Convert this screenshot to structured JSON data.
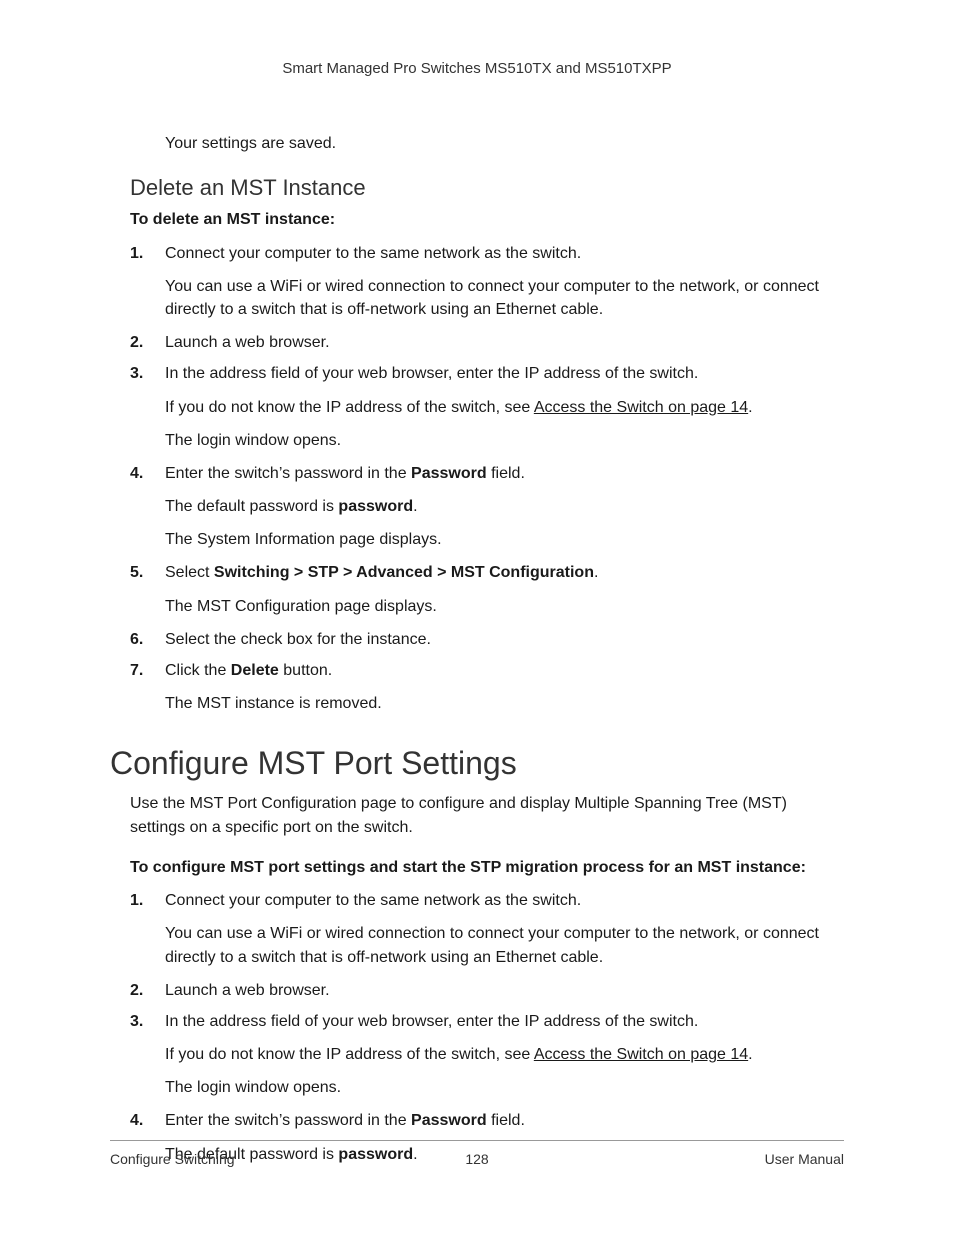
{
  "header": "Smart Managed Pro Switches MS510TX and MS510TXPP",
  "intro_saved": "Your settings are saved.",
  "sub1": {
    "title": "Delete an MST Instance",
    "lead": "To delete an MST instance:",
    "steps": {
      "s1": "Connect your computer to the same network as the switch.",
      "s1_p": "You can use a WiFi or wired connection to connect your computer to the network, or connect directly to a switch that is off-network using an Ethernet cable.",
      "s2": "Launch a web browser.",
      "s3": "In the address field of your web browser, enter the IP address of the switch.",
      "s3_p_pre": "If you do not know the IP address of the switch, see ",
      "s3_link": "Access the Switch on page 14",
      "s3_p_post": ".",
      "s3_p2": "The login window opens.",
      "s4_pre": "Enter the switch’s password in the ",
      "s4_bold": "Password",
      "s4_post": " field.",
      "s4_p_pre": "The default password is ",
      "s4_p_bold": "password",
      "s4_p_post": ".",
      "s4_p2": "The System Information page displays.",
      "s5_pre": "Select ",
      "s5_bold": "Switching > STP > Advanced > MST Configuration",
      "s5_post": ".",
      "s5_p": "The MST Configuration page displays.",
      "s6": "Select the check box for the instance.",
      "s7_pre": "Click the ",
      "s7_bold": "Delete",
      "s7_post": " button.",
      "s7_p": "The MST instance is removed."
    }
  },
  "section2": {
    "title": "Configure MST Port Settings",
    "intro": "Use the MST Port Configuration page to configure and display Multiple Spanning Tree (MST) settings on a specific port on the switch.",
    "lead": "To configure MST port settings and start the STP migration process for an MST instance:",
    "steps": {
      "s1": "Connect your computer to the same network as the switch.",
      "s1_p": "You can use a WiFi or wired connection to connect your computer to the network, or connect directly to a switch that is off-network using an Ethernet cable.",
      "s2": "Launch a web browser.",
      "s3": "In the address field of your web browser, enter the IP address of the switch.",
      "s3_p_pre": "If you do not know the IP address of the switch, see ",
      "s3_link": "Access the Switch on page 14",
      "s3_p_post": ".",
      "s3_p2": "The login window opens.",
      "s4_pre": "Enter the switch’s password in the ",
      "s4_bold": "Password",
      "s4_post": " field.",
      "s4_p_pre": "The default password is ",
      "s4_p_bold": "password",
      "s4_p_post": "."
    }
  },
  "footer": {
    "left": "Configure Switching",
    "center": "128",
    "right": "User Manual"
  }
}
